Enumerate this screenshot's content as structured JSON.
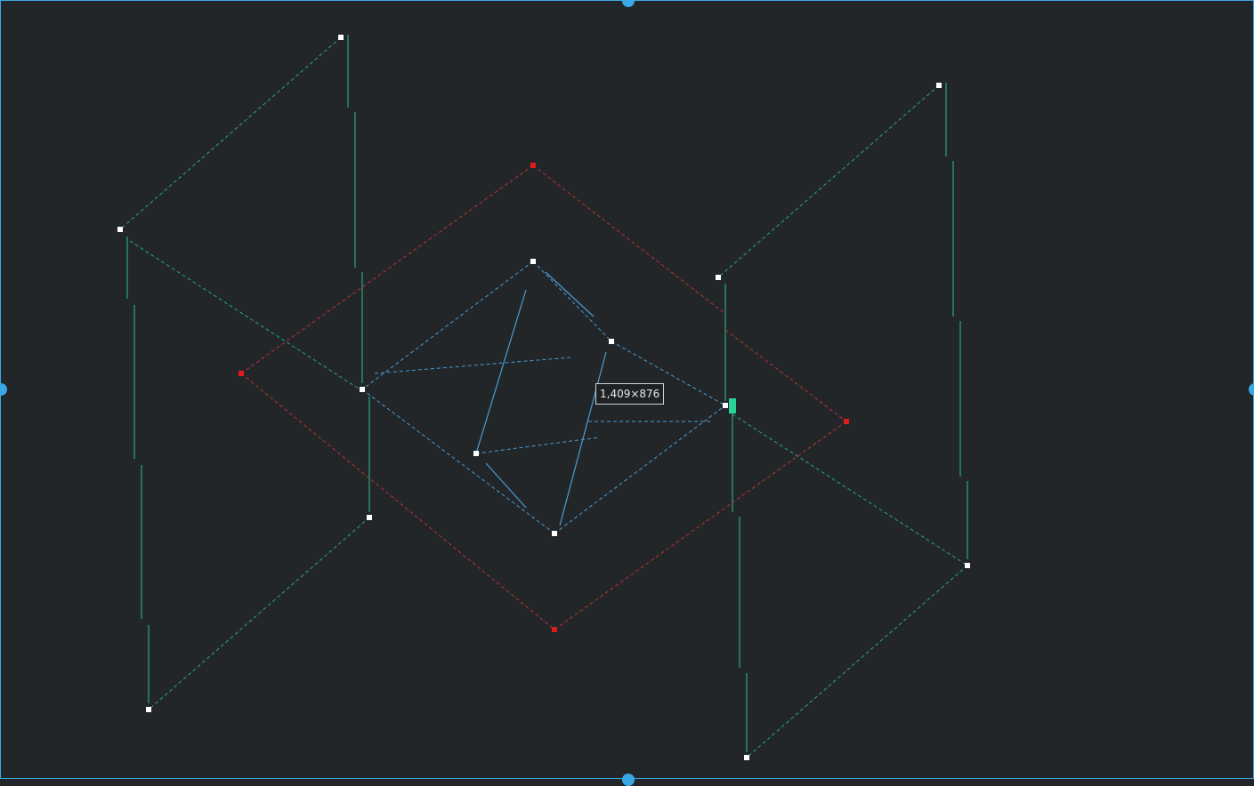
{
  "tooltip": {
    "size_label": "1,409×876"
  },
  "colors": {
    "background": "#222628",
    "selection_border": "#3aa8e6",
    "green_lines": "#2aa67f",
    "red_lines": "#b8362e",
    "blue_lines": "#4a9cd6",
    "node_white": "#ffffff",
    "node_red": "#e01b1b",
    "cursor": "#2ad19a"
  },
  "icons": [
    "resize-handle-icon",
    "text-cursor-icon"
  ]
}
